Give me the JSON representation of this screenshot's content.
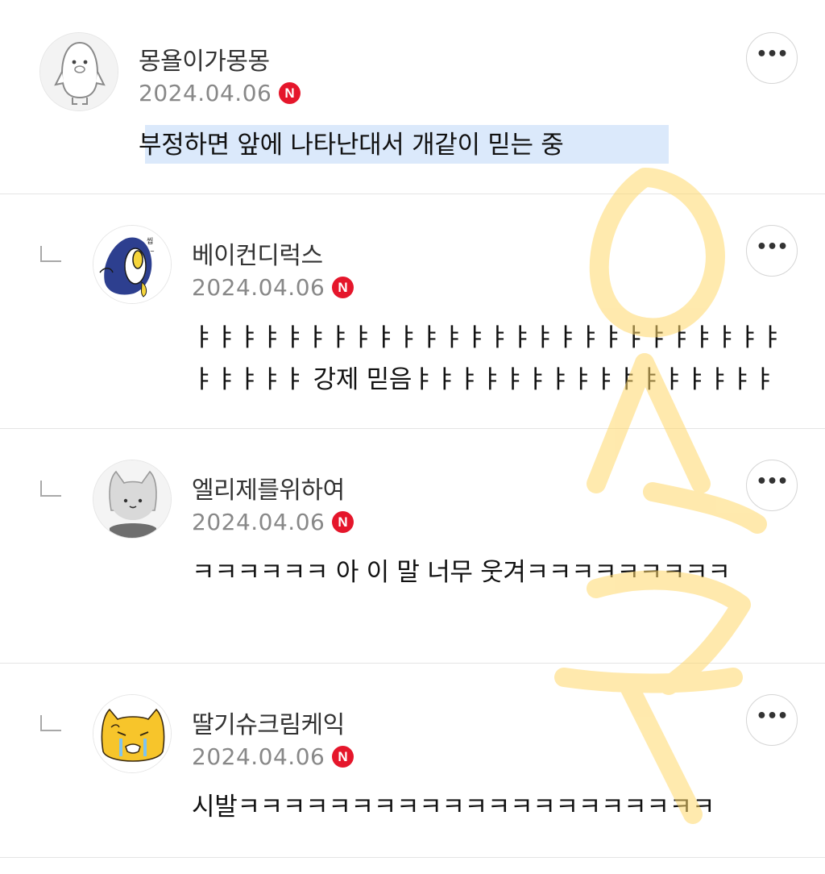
{
  "comments": [
    {
      "author": "몽욜이가몽몽",
      "date": "2024.04.06",
      "badge": "N",
      "text": "부정하면 앞에 나타난대서 개같이 믿는 중",
      "is_reply": false,
      "highlighted": true,
      "avatar_icon": "penguin-icon"
    },
    {
      "author": "베이컨디럭스",
      "date": "2024.04.06",
      "badge": "N",
      "text": "ㅑㅑㅑㅑㅑㅑㅑㅑㅑㅑㅑㅑㅑㅑㅑㅑㅑㅑㅑㅑㅑㅑㅑㅑㅑㅑㅑㅑㅑㅑㅑ 강제 믿음ㅑㅑㅑㅑㅑㅑㅑㅑㅑㅑㅑㅑㅑㅑㅑㅑ",
      "is_reply": true,
      "avatar_icon": "penguin-sticker-icon"
    },
    {
      "author": "엘리제를위하여",
      "date": "2024.04.06",
      "badge": "N",
      "text": "ㅋㅋㅋㅋㅋㅋ 아 이 말 너무 웃겨ㅋㅋㅋㅋㅋㅋㅋㅋㅋ",
      "is_reply": true,
      "avatar_icon": "cat-icon"
    },
    {
      "author": "딸기슈크림케익",
      "date": "2024.04.06",
      "badge": "N",
      "text": "시발ㅋㅋㅋㅋㅋㅋㅋㅋㅋㅋㅋㅋㅋㅋㅋㅋㅋㅋㅋㅋㅋ",
      "is_reply": true,
      "avatar_icon": "crying-cat-icon"
    }
  ],
  "more_label": "•••",
  "watermark_color": "#ffd86b"
}
